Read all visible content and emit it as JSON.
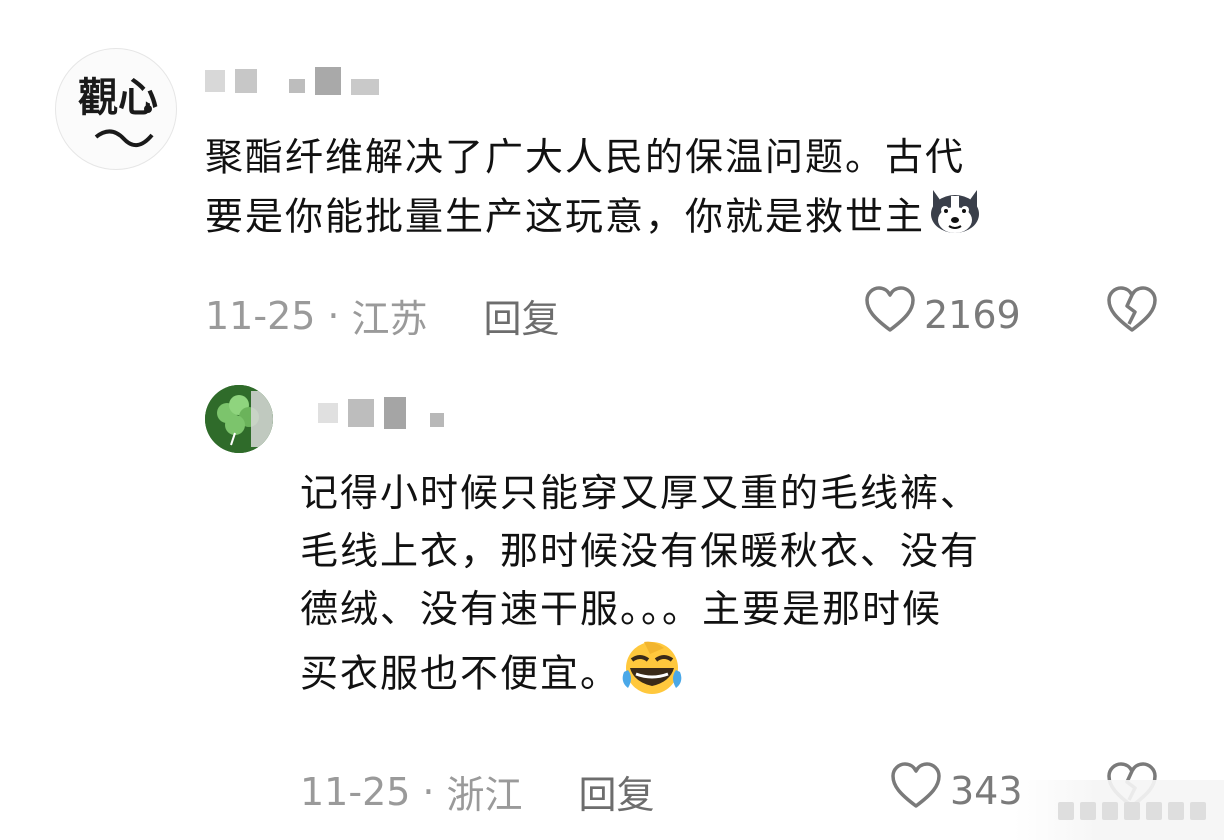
{
  "comments": [
    {
      "avatar_name": "calligraphy-avatar",
      "avatar_text": "觀心",
      "text_line1": "聚酯纤维解决了广大人民的保温问题。古代",
      "text_line2": "要是你能批量生产这玩意，你就是救世主",
      "date": "11-25",
      "separator": "·",
      "location": "江苏",
      "reply_label": "回复",
      "like_count": "2169",
      "inline_emoji": "husky-emoji"
    },
    {
      "avatar_name": "clover-avatar",
      "text_line1": "记得小时候只能穿又厚又重的毛线裤、",
      "text_line2": "毛线上衣，那时候没有保暖秋衣、没有",
      "text_line3": "德绒、没有速干服。。。主要是那时候",
      "text_line4": "买衣服也不便宜。",
      "date": "11-25",
      "separator": "·",
      "location": "浙江",
      "reply_label": "回复",
      "like_count": "343",
      "inline_emoji": "laughing-crying-emoji"
    }
  ],
  "icons": {
    "like": "heart-outline-icon",
    "dislike": "broken-heart-icon"
  },
  "colors": {
    "text": "#111111",
    "meta": "#9a9a9a",
    "reply": "#6d6d6d",
    "icon": "#7a7a7a"
  }
}
